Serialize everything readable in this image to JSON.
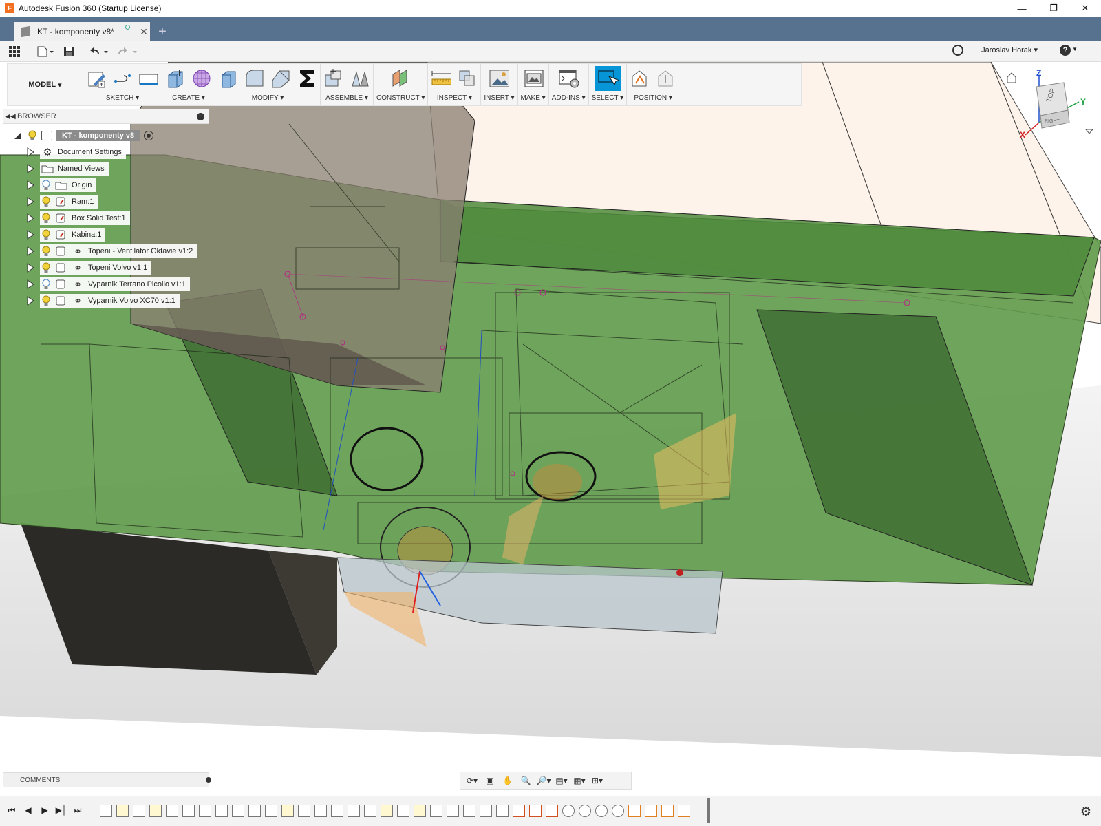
{
  "window": {
    "title": "Autodesk Fusion 360 (Startup License)"
  },
  "tab": {
    "label": "KT - komponenty v8*"
  },
  "header": {
    "user": "Jaroslav Horak"
  },
  "toolbar": {
    "workspace": "MODEL",
    "groups": [
      {
        "label": "SKETCH"
      },
      {
        "label": "CREATE"
      },
      {
        "label": "MODIFY"
      },
      {
        "label": "ASSEMBLE"
      },
      {
        "label": "CONSTRUCT"
      },
      {
        "label": "INSPECT"
      },
      {
        "label": "INSERT"
      },
      {
        "label": "MAKE"
      },
      {
        "label": "ADD-INS"
      },
      {
        "label": "SELECT"
      },
      {
        "label": "POSITION"
      }
    ]
  },
  "browser": {
    "title": "BROWSER",
    "root": "KT - komponenty v8",
    "items": [
      {
        "label": "Document Settings",
        "icon": "gear-icon"
      },
      {
        "label": "Named Views",
        "icon": "folder-icon"
      },
      {
        "label": "Origin",
        "icon": "folder-icon"
      },
      {
        "label": "Ram:1",
        "icon": "component-icon"
      },
      {
        "label": "Box Solid Test:1",
        "icon": "component-icon"
      },
      {
        "label": "Kabina:1",
        "icon": "component-icon"
      },
      {
        "label": "Topeni - Ventilator Oktavie v1:2",
        "icon": "link-icon"
      },
      {
        "label": "Topeni Volvo v1:1",
        "icon": "link-icon"
      },
      {
        "label": "Vyparnik Terrano Picollo v1:1",
        "icon": "link-icon"
      },
      {
        "label": "Vyparnik Volvo XC70 v1:1",
        "icon": "link-icon"
      }
    ]
  },
  "viewcube": {
    "top": "TOP",
    "right": "RIGHT"
  },
  "comments": {
    "label": "COMMENTS"
  },
  "colors": {
    "title_bar": "#ffffff",
    "tab_bar": "#56728f",
    "model_green": "#5f9a4a",
    "select_accent": "#0696d7",
    "ground": "#e6e6e6",
    "back_panel": "#fdf3ea"
  }
}
